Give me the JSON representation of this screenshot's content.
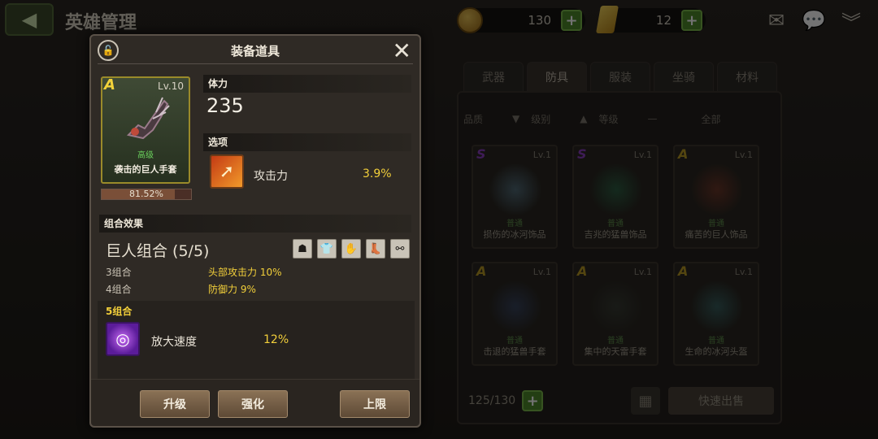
{
  "header": {
    "title": "英雄管理",
    "coins": "130",
    "gold": "12"
  },
  "tabs": [
    {
      "label": "武器",
      "active": false,
      "badge": false
    },
    {
      "label": "防具",
      "active": true,
      "badge": false
    },
    {
      "label": "服装",
      "active": false,
      "badge": false
    },
    {
      "label": "坐骑",
      "active": false,
      "badge": true
    },
    {
      "label": "材料",
      "active": false,
      "badge": true
    }
  ],
  "filters": {
    "quality": "品质",
    "level": "级别",
    "rank": "等级",
    "dash": "—",
    "all": "全部"
  },
  "inventory": [
    {
      "grade": "S",
      "level": "Lv.1",
      "quality": "普通",
      "name": "损伤的冰河饰品",
      "grade_color": "#8a3fbf",
      "art_color": "#5a7a8a"
    },
    {
      "grade": "S",
      "level": "Lv.1",
      "quality": "普通",
      "name": "吉兆的猛兽饰品",
      "grade_color": "#8a3fbf",
      "art_color": "#2f6a4a"
    },
    {
      "grade": "A",
      "level": "Lv.1",
      "quality": "普通",
      "name": "痛苦的巨人饰品",
      "grade_color": "#b89a24",
      "art_color": "#7a3a2a"
    },
    {
      "grade": "A",
      "level": "Lv.1",
      "quality": "普通",
      "name": "击退的猛兽手套",
      "grade_color": "#b89a24",
      "art_color": "#3a4a6a"
    },
    {
      "grade": "A",
      "level": "Lv.1",
      "quality": "普通",
      "name": "集中的天雷手套",
      "grade_color": "#b89a24",
      "art_color": "#3a4038"
    },
    {
      "grade": "A",
      "level": "Lv.1",
      "quality": "普通",
      "name": "生命的冰河头盔",
      "grade_color": "#b89a24",
      "art_color": "#3a6a6a"
    }
  ],
  "inventory_count": "125/130",
  "sell_label": "快速出售",
  "modal": {
    "title": "装备道具",
    "item": {
      "grade": "A",
      "level": "Lv.10",
      "quality": "高级",
      "name": "袭击的巨人手套",
      "exp_text": "81.52%",
      "exp_fraction": 0.8152
    },
    "stat_header": "体力",
    "stat_value": "235",
    "option_header": "选项",
    "option": {
      "name": "攻击力",
      "value": "3.9%"
    },
    "set_header": "组合效果",
    "set_name": "巨人组合 (5/5)",
    "set_icons": [
      "helmet-icon",
      "armor-icon",
      "gauntlet-icon",
      "boots-icon",
      "accessory-icon"
    ],
    "set_bonuses": [
      {
        "tier": "3组合",
        "effect": "头部攻击力 10%"
      },
      {
        "tier": "4组合",
        "effect": "防御力 9%"
      }
    ],
    "bonus5": {
      "tier": "5组合",
      "name": "放大速度",
      "value": "12%"
    },
    "buttons": {
      "upgrade": "升级",
      "enhance": "强化",
      "limit": "上限"
    }
  }
}
